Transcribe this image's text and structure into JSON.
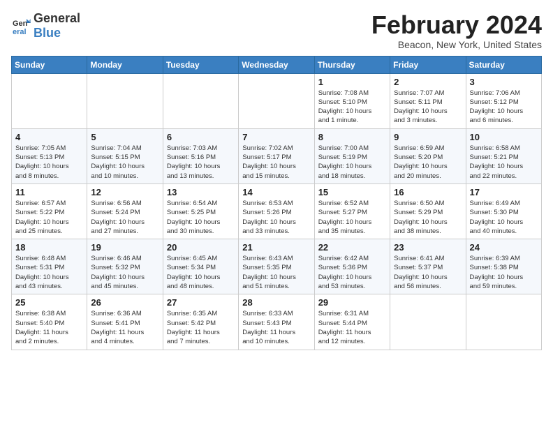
{
  "header": {
    "logo_general": "General",
    "logo_blue": "Blue",
    "title": "February 2024",
    "subtitle": "Beacon, New York, United States"
  },
  "weekdays": [
    "Sunday",
    "Monday",
    "Tuesday",
    "Wednesday",
    "Thursday",
    "Friday",
    "Saturday"
  ],
  "weeks": [
    [
      {
        "day": "",
        "info": ""
      },
      {
        "day": "",
        "info": ""
      },
      {
        "day": "",
        "info": ""
      },
      {
        "day": "",
        "info": ""
      },
      {
        "day": "1",
        "info": "Sunrise: 7:08 AM\nSunset: 5:10 PM\nDaylight: 10 hours\nand 1 minute."
      },
      {
        "day": "2",
        "info": "Sunrise: 7:07 AM\nSunset: 5:11 PM\nDaylight: 10 hours\nand 3 minutes."
      },
      {
        "day": "3",
        "info": "Sunrise: 7:06 AM\nSunset: 5:12 PM\nDaylight: 10 hours\nand 6 minutes."
      }
    ],
    [
      {
        "day": "4",
        "info": "Sunrise: 7:05 AM\nSunset: 5:13 PM\nDaylight: 10 hours\nand 8 minutes."
      },
      {
        "day": "5",
        "info": "Sunrise: 7:04 AM\nSunset: 5:15 PM\nDaylight: 10 hours\nand 10 minutes."
      },
      {
        "day": "6",
        "info": "Sunrise: 7:03 AM\nSunset: 5:16 PM\nDaylight: 10 hours\nand 13 minutes."
      },
      {
        "day": "7",
        "info": "Sunrise: 7:02 AM\nSunset: 5:17 PM\nDaylight: 10 hours\nand 15 minutes."
      },
      {
        "day": "8",
        "info": "Sunrise: 7:00 AM\nSunset: 5:19 PM\nDaylight: 10 hours\nand 18 minutes."
      },
      {
        "day": "9",
        "info": "Sunrise: 6:59 AM\nSunset: 5:20 PM\nDaylight: 10 hours\nand 20 minutes."
      },
      {
        "day": "10",
        "info": "Sunrise: 6:58 AM\nSunset: 5:21 PM\nDaylight: 10 hours\nand 22 minutes."
      }
    ],
    [
      {
        "day": "11",
        "info": "Sunrise: 6:57 AM\nSunset: 5:22 PM\nDaylight: 10 hours\nand 25 minutes."
      },
      {
        "day": "12",
        "info": "Sunrise: 6:56 AM\nSunset: 5:24 PM\nDaylight: 10 hours\nand 27 minutes."
      },
      {
        "day": "13",
        "info": "Sunrise: 6:54 AM\nSunset: 5:25 PM\nDaylight: 10 hours\nand 30 minutes."
      },
      {
        "day": "14",
        "info": "Sunrise: 6:53 AM\nSunset: 5:26 PM\nDaylight: 10 hours\nand 33 minutes."
      },
      {
        "day": "15",
        "info": "Sunrise: 6:52 AM\nSunset: 5:27 PM\nDaylight: 10 hours\nand 35 minutes."
      },
      {
        "day": "16",
        "info": "Sunrise: 6:50 AM\nSunset: 5:29 PM\nDaylight: 10 hours\nand 38 minutes."
      },
      {
        "day": "17",
        "info": "Sunrise: 6:49 AM\nSunset: 5:30 PM\nDaylight: 10 hours\nand 40 minutes."
      }
    ],
    [
      {
        "day": "18",
        "info": "Sunrise: 6:48 AM\nSunset: 5:31 PM\nDaylight: 10 hours\nand 43 minutes."
      },
      {
        "day": "19",
        "info": "Sunrise: 6:46 AM\nSunset: 5:32 PM\nDaylight: 10 hours\nand 45 minutes."
      },
      {
        "day": "20",
        "info": "Sunrise: 6:45 AM\nSunset: 5:34 PM\nDaylight: 10 hours\nand 48 minutes."
      },
      {
        "day": "21",
        "info": "Sunrise: 6:43 AM\nSunset: 5:35 PM\nDaylight: 10 hours\nand 51 minutes."
      },
      {
        "day": "22",
        "info": "Sunrise: 6:42 AM\nSunset: 5:36 PM\nDaylight: 10 hours\nand 53 minutes."
      },
      {
        "day": "23",
        "info": "Sunrise: 6:41 AM\nSunset: 5:37 PM\nDaylight: 10 hours\nand 56 minutes."
      },
      {
        "day": "24",
        "info": "Sunrise: 6:39 AM\nSunset: 5:38 PM\nDaylight: 10 hours\nand 59 minutes."
      }
    ],
    [
      {
        "day": "25",
        "info": "Sunrise: 6:38 AM\nSunset: 5:40 PM\nDaylight: 11 hours\nand 2 minutes."
      },
      {
        "day": "26",
        "info": "Sunrise: 6:36 AM\nSunset: 5:41 PM\nDaylight: 11 hours\nand 4 minutes."
      },
      {
        "day": "27",
        "info": "Sunrise: 6:35 AM\nSunset: 5:42 PM\nDaylight: 11 hours\nand 7 minutes."
      },
      {
        "day": "28",
        "info": "Sunrise: 6:33 AM\nSunset: 5:43 PM\nDaylight: 11 hours\nand 10 minutes."
      },
      {
        "day": "29",
        "info": "Sunrise: 6:31 AM\nSunset: 5:44 PM\nDaylight: 11 hours\nand 12 minutes."
      },
      {
        "day": "",
        "info": ""
      },
      {
        "day": "",
        "info": ""
      }
    ]
  ]
}
